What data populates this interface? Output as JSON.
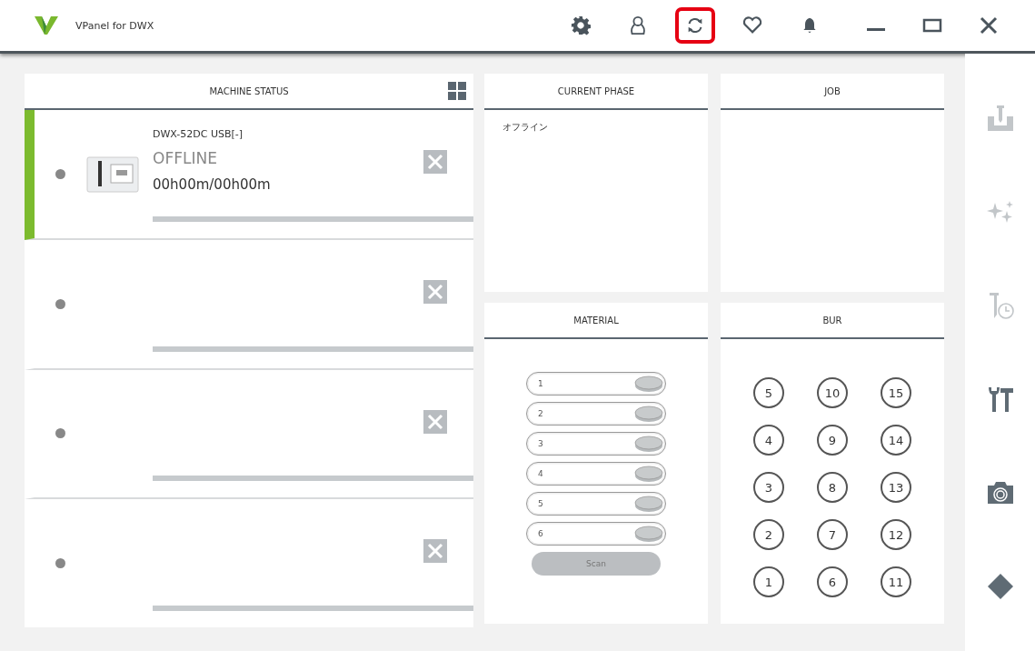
{
  "window": {
    "title": "VPanel for DWX"
  },
  "toolbar": [
    {
      "kind": "gear",
      "highlighted": false
    },
    {
      "kind": "user",
      "highlighted": false
    },
    {
      "kind": "refresh",
      "highlighted": true
    },
    {
      "kind": "heart",
      "highlighted": false
    },
    {
      "kind": "bell",
      "highlighted": false
    }
  ],
  "machine_status": {
    "title": "MACHINE STATUS",
    "machines": [
      {
        "name": "DWX-52DC USB[-]",
        "status": "OFFLINE",
        "time": "00h00m/00h00m",
        "selected": true
      },
      {
        "selected": false
      },
      {
        "selected": false
      },
      {
        "selected": false
      }
    ]
  },
  "current_phase": {
    "title": "CURRENT PHASE",
    "text": "オフライン"
  },
  "job": {
    "title": "JOB"
  },
  "material": {
    "title": "MATERIAL",
    "slots": [
      "1",
      "2",
      "3",
      "4",
      "5",
      "6"
    ],
    "scan_button": {
      "label": "Scan",
      "disabled": true
    }
  },
  "bur": {
    "title": "BUR",
    "columns": [
      [
        "5",
        "4",
        "3",
        "2",
        "1"
      ],
      [
        "10",
        "9",
        "8",
        "7",
        "6"
      ],
      [
        "15",
        "14",
        "13",
        "12",
        "11"
      ]
    ]
  },
  "sidebar": [
    {
      "kind": "milling",
      "disabled": true
    },
    {
      "kind": "sparkle",
      "disabled": true
    },
    {
      "kind": "bur-time",
      "disabled": true
    },
    {
      "kind": "tools",
      "disabled": false
    },
    {
      "kind": "camera",
      "disabled": false
    },
    {
      "kind": "diamond",
      "disabled": false
    }
  ]
}
